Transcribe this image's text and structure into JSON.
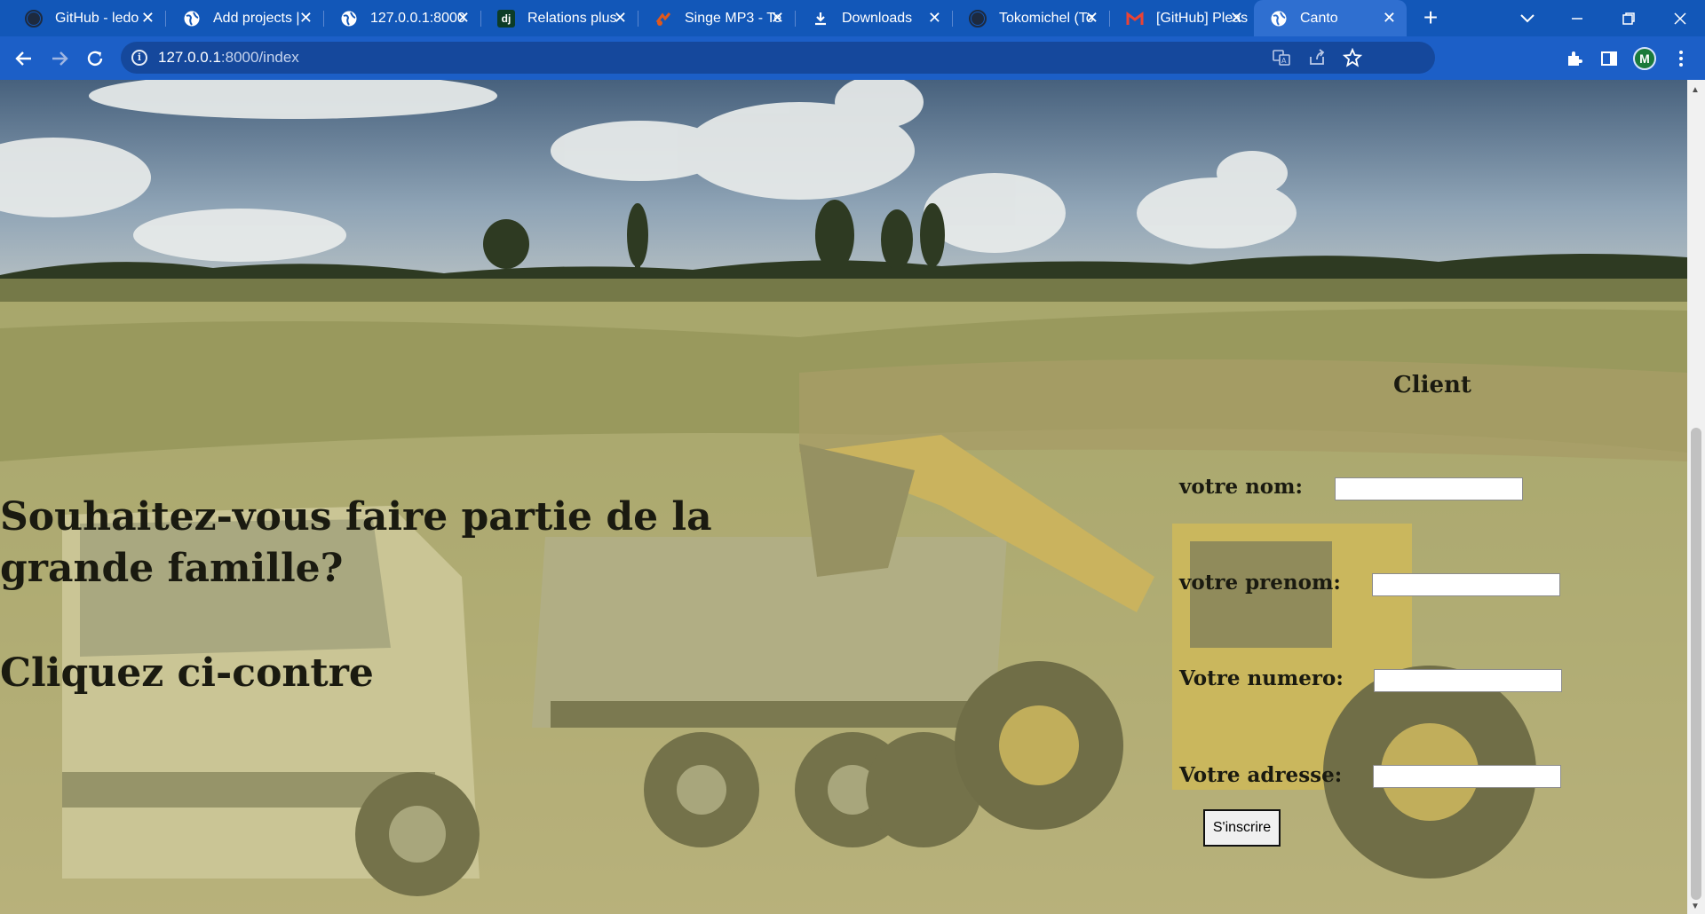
{
  "browser": {
    "tabs": [
      {
        "label": "GitHub - ledo",
        "icon": "github-icon"
      },
      {
        "label": "Add projects |",
        "icon": "globe-icon"
      },
      {
        "label": "127.0.0.1:8000",
        "icon": "globe-icon"
      },
      {
        "label": "Relations plus",
        "icon": "django-icon"
      },
      {
        "label": "Singe MP3 - Te",
        "icon": "music-icon"
      },
      {
        "label": "Downloads",
        "icon": "download-icon"
      },
      {
        "label": "Tokomichel (To",
        "icon": "github-icon"
      },
      {
        "label": "[GitHub] Pleas",
        "icon": "gmail-icon"
      },
      {
        "label": "Canto",
        "icon": "globe-icon",
        "active": true
      }
    ],
    "url_host": "127.0.0.1",
    "url_rest": ":8000/index",
    "profile_initial": "M",
    "colors": {
      "tabbar": "#1257b8",
      "toolbar": "#1c5fc7",
      "profile": "#1b7a3a"
    }
  },
  "page": {
    "headline": "Souhaitez-vous faire partie de la grande famille?",
    "cta": "Cliquez ci-contre",
    "form": {
      "title": "Client",
      "fields": [
        {
          "label": "votre nom:",
          "value": ""
        },
        {
          "label": "votre prenom:",
          "value": ""
        },
        {
          "label": "Votre numero:",
          "value": ""
        },
        {
          "label": "Votre adresse:",
          "value": ""
        }
      ],
      "submit_label": "S'inscrire"
    }
  }
}
